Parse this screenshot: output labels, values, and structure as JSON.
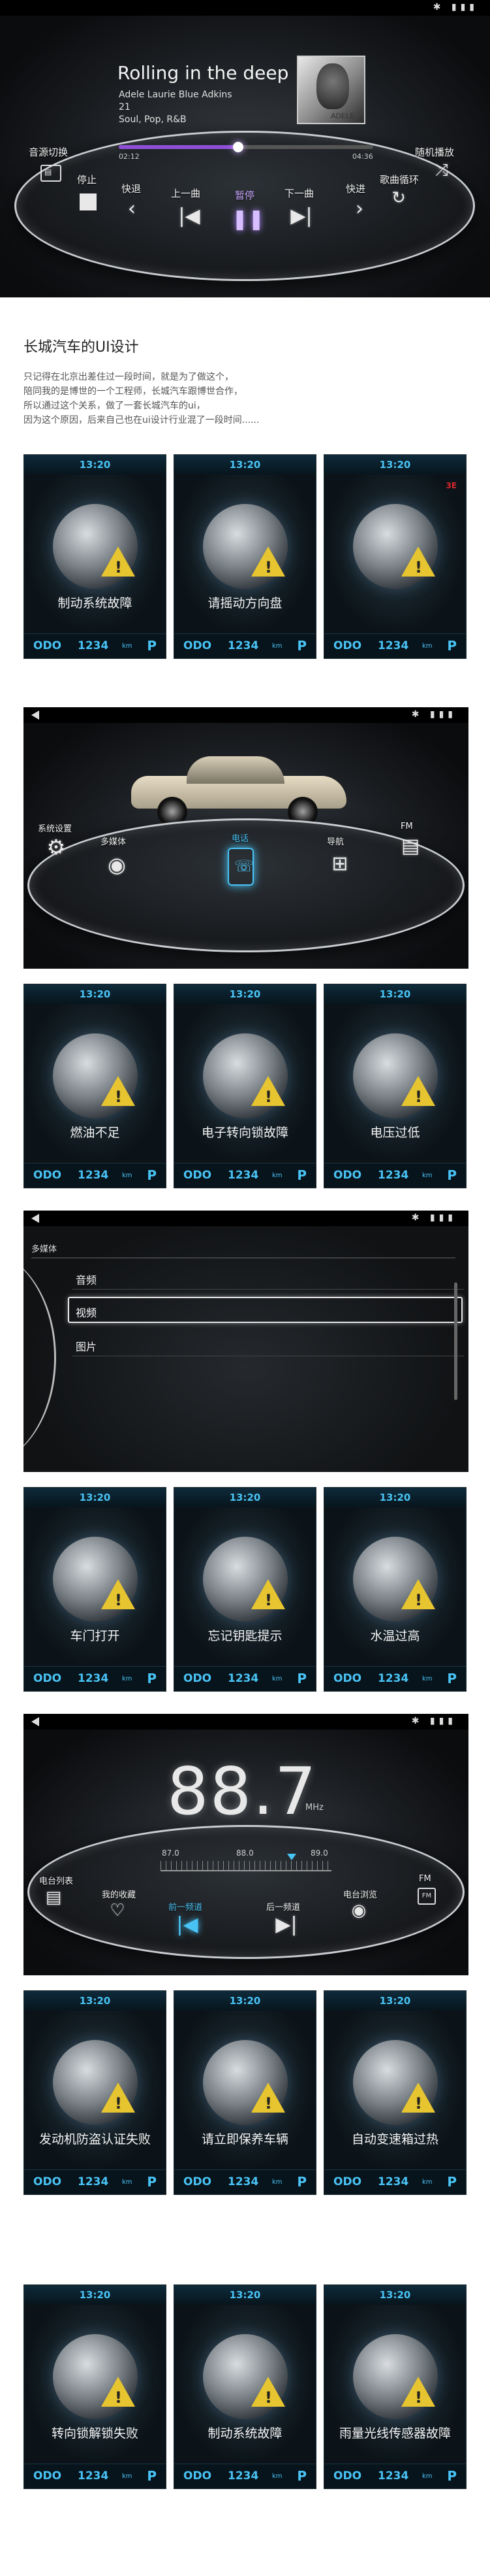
{
  "music_screen": {
    "song_title": "Rolling in the deep",
    "artist_line": "Adele Laurie Blue Adkins",
    "album_line": "21",
    "genre_line": "Soul, Pop, R&B",
    "album_art_text": "ADELE",
    "time_elapsed": "02:12",
    "time_total": "04:36",
    "progress_fraction": 0.47,
    "controls": {
      "source": "音源切换",
      "stop": "停止",
      "rewind": "快退",
      "prev": "上一曲",
      "pause": "暂停",
      "next": "下一曲",
      "forward": "快进",
      "loop": "歌曲循环",
      "shuffle": "随机播放"
    }
  },
  "intro": {
    "title": "长城汽车的UI设计",
    "lines": [
      "只记得在北京出差住过一段时间，就是为了做这个，",
      "陪同我的是博世的一个工程师，长城汽车跟博世合作，",
      "所以通过这个关系，做了一套长城汽车的ui，",
      "因为这个原因，后来自己也在ui设计行业混了一段时间......"
    ]
  },
  "card_footer": {
    "odo_label": "ODO",
    "odo_value": "1234",
    "odo_unit": "km",
    "gear": "P"
  },
  "card_time": "13:20",
  "cards_row1": [
    "制动系统故障",
    "请摇动方向盘",
    ""
  ],
  "cards_row2": [
    "燃油不足",
    "电子转向锁故障",
    "电压过低"
  ],
  "cards_row3": [
    "车门打开",
    "忘记钥匙提示",
    "水温过高"
  ],
  "cards_row4": [
    "发动机防盗认证失败",
    "请立即保养车辆",
    "自动变速箱过热"
  ],
  "cards_row5": [
    "转向锁解锁失败",
    "制动系统故障",
    "雨量光线传感器故障"
  ],
  "car_label": "3E",
  "main_menu": {
    "items": [
      "系统设置",
      "多媒体",
      "电话",
      "导航",
      "FM"
    ]
  },
  "multimedia": {
    "title": "多媒体",
    "items": [
      "音频",
      "视频",
      "图片"
    ],
    "selected": "视频"
  },
  "radio": {
    "frequency": "88.7",
    "unit": "MHz",
    "scale_left": "87.0",
    "scale_mid": "88.0",
    "scale_right": "89.0",
    "controls": {
      "list": "电台列表",
      "fav": "我的收藏",
      "prev": "前一频道",
      "next": "后一频道",
      "browse": "电台浏览",
      "fm": "FM"
    }
  },
  "colors": {
    "accent_blue": "#49c3f5",
    "progress_purple": "#8e4fd6",
    "warning_yellow": "#e7c530",
    "alert_red": "#d8282d"
  }
}
